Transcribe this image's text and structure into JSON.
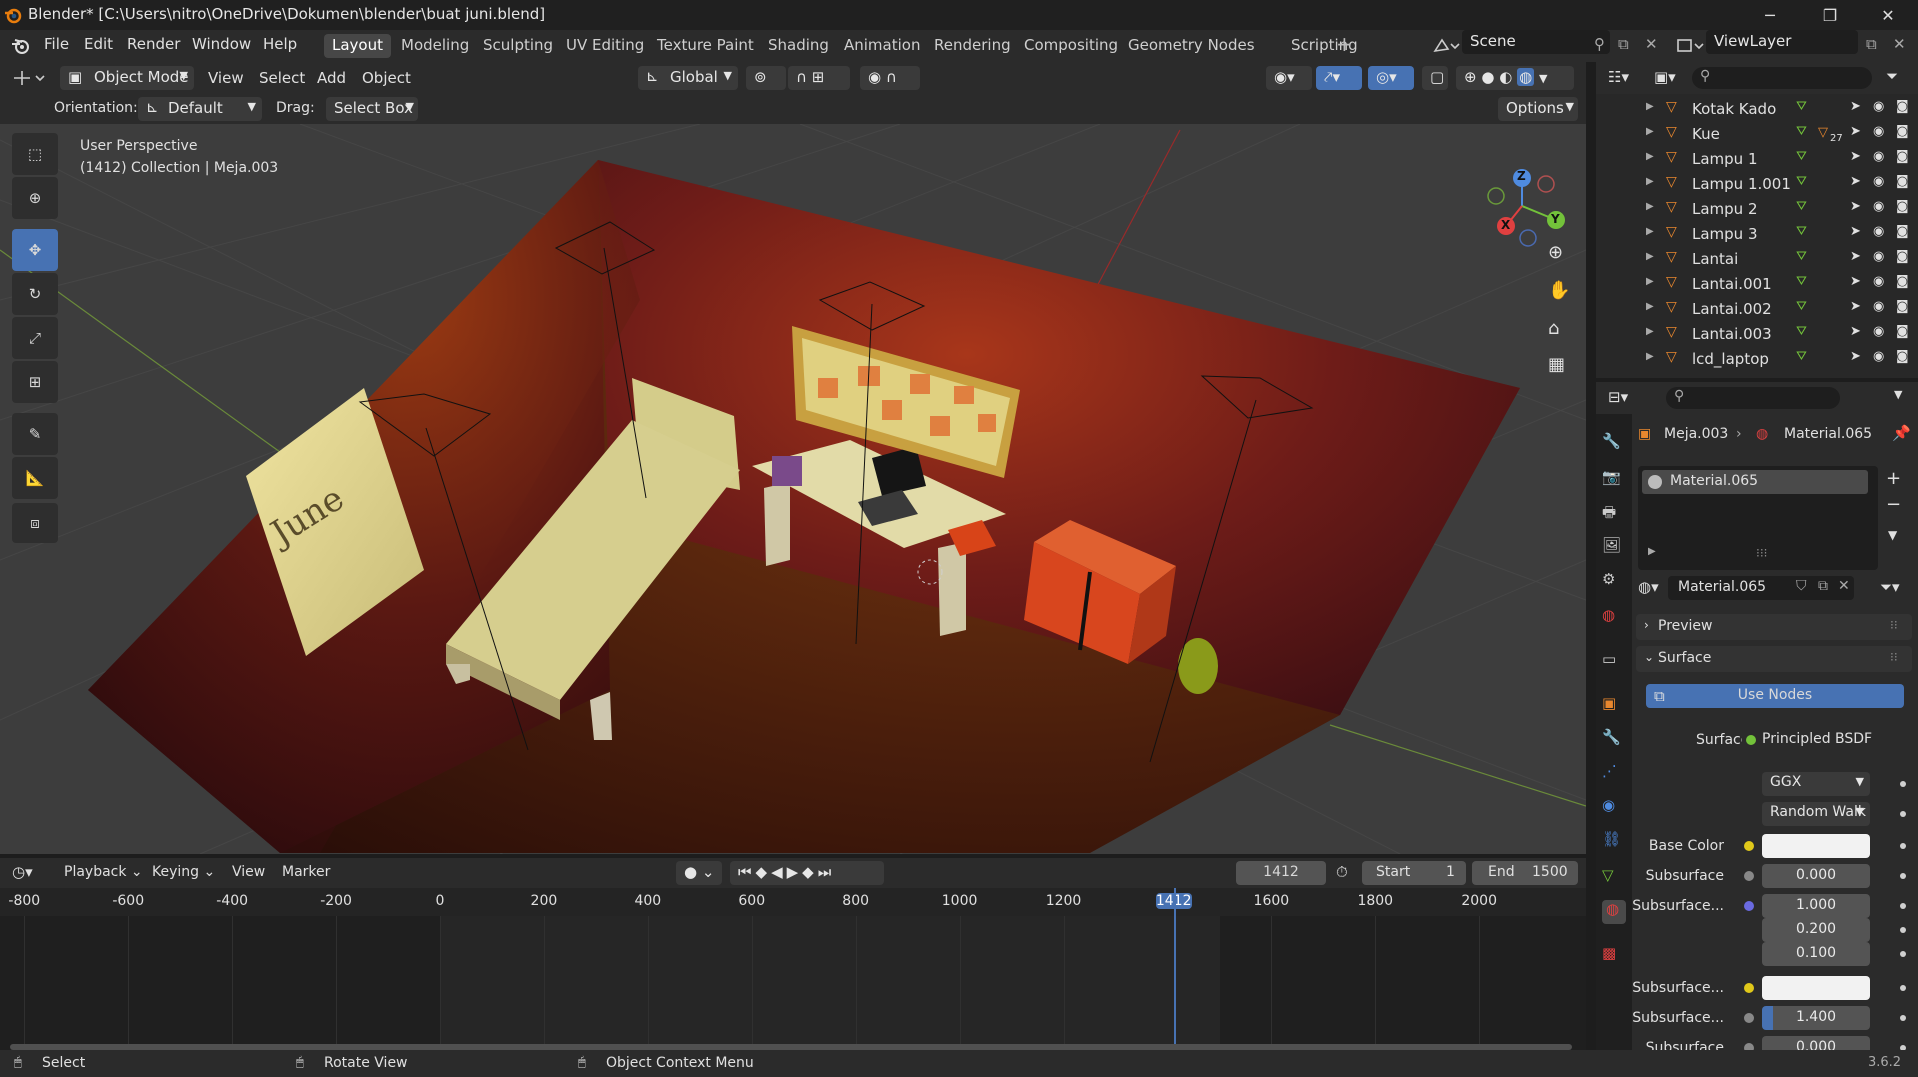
{
  "window": {
    "title": "Blender* [C:\\Users\\nitro\\OneDrive\\Dokumen\\blender\\buat juni.blend]",
    "min": "─",
    "max": "❐",
    "close": "✕"
  },
  "menu": {
    "file": "File",
    "edit": "Edit",
    "render": "Render",
    "window": "Window",
    "help": "Help"
  },
  "workspaces": [
    "Layout",
    "Modeling",
    "Sculpting",
    "UV Editing",
    "Texture Paint",
    "Shading",
    "Animation",
    "Rendering",
    "Compositing",
    "Geometry Nodes",
    "Scripting"
  ],
  "scene": {
    "name": "Scene",
    "view_layer": "ViewLayer"
  },
  "viewport_header": {
    "mode": "Object Mode",
    "view": "View",
    "select": "Select",
    "add": "Add",
    "object": "Object",
    "transform": "Global"
  },
  "tool_settings": {
    "orientation_label": "Orientation:",
    "orientation_value": "Default",
    "drag_label": "Drag:",
    "drag_value": "Select Box",
    "options": "Options"
  },
  "viewport": {
    "line1": "User Perspective",
    "line2": "(1412) Collection | Meja.003",
    "poster_text": "June",
    "gizmo": {
      "z": "Z",
      "y": "Y",
      "x": "X"
    }
  },
  "outliner": {
    "items": [
      {
        "name": "Kotak Kado"
      },
      {
        "name": "Kue",
        "badge": "27"
      },
      {
        "name": "Lampu 1"
      },
      {
        "name": "Lampu 1.001"
      },
      {
        "name": "Lampu 2"
      },
      {
        "name": "Lampu 3"
      },
      {
        "name": "Lantai"
      },
      {
        "name": "Lantai.001"
      },
      {
        "name": "Lantai.002"
      },
      {
        "name": "Lantai.003"
      },
      {
        "name": "lcd_laptop"
      }
    ]
  },
  "properties": {
    "breadcrumb_object": "Meja.003",
    "breadcrumb_material": "Material.065",
    "slot_name": "Material.065",
    "material_name": "Material.065",
    "preview": "Preview",
    "surface_panel": "Surface",
    "use_nodes": "Use Nodes",
    "surface_label": "Surface",
    "surface_value": "Principled BSDF",
    "distribution": "GGX",
    "subsurface_method": "Random Walk",
    "fields": [
      {
        "label": "Base Color",
        "value": ""
      },
      {
        "label": "Subsurface",
        "value": "0.000"
      },
      {
        "label": "Subsurface...",
        "value": "1.000"
      },
      {
        "label": "",
        "value": "0.200"
      },
      {
        "label": "",
        "value": "0.100"
      },
      {
        "label": "Subsurface...",
        "value": ""
      },
      {
        "label": "Subsurface...",
        "value": "1.400"
      },
      {
        "label": "Subsurface",
        "value": "0.000"
      }
    ]
  },
  "timeline": {
    "playback": "Playback",
    "keying": "Keying",
    "view": "View",
    "marker": "Marker",
    "current_frame": "1412",
    "start_label": "Start",
    "start": "1",
    "end_label": "End",
    "end": "1500",
    "ruler": [
      "-800",
      "-600",
      "-400",
      "-200",
      "0",
      "200",
      "400",
      "600",
      "800",
      "1000",
      "1200",
      "1412",
      "1600",
      "1800",
      "2000"
    ]
  },
  "status": {
    "select": "Select",
    "rotate": "Rotate View",
    "context": "Object Context Menu",
    "version": "3.6.2"
  },
  "colors": {
    "accent": "#4772b3",
    "orange": "#e8872e",
    "green": "#73c23a"
  }
}
